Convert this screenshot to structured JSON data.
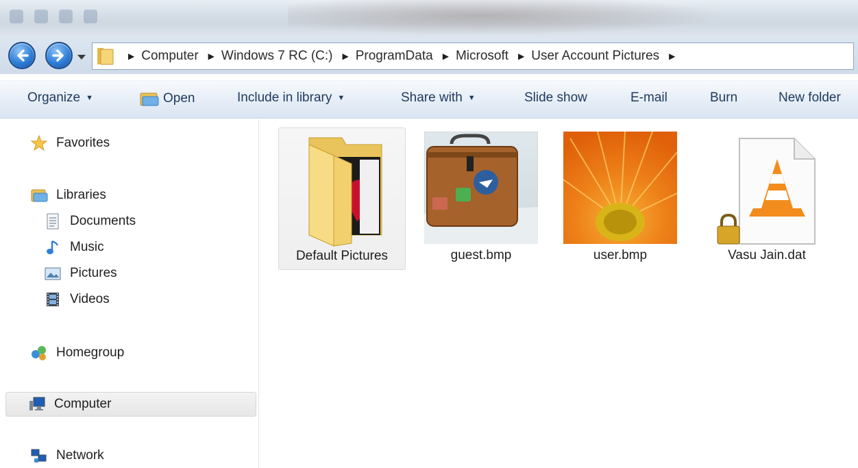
{
  "address_bar": {
    "breadcrumbs": [
      "Computer",
      "Windows 7 RC (C:)",
      "ProgramData",
      "Microsoft",
      "User Account Pictures"
    ]
  },
  "command_bar": {
    "organize": "Organize",
    "open": "Open",
    "include_in_library": "Include in library",
    "share_with": "Share with",
    "slide_show": "Slide show",
    "email": "E-mail",
    "burn": "Burn",
    "new_folder": "New folder"
  },
  "navigation": {
    "favorites": "Favorites",
    "libraries": "Libraries",
    "documents": "Documents",
    "music": "Music",
    "pictures": "Pictures",
    "videos": "Videos",
    "homegroup": "Homegroup",
    "computer": "Computer",
    "network": "Network"
  },
  "files": [
    {
      "name": "Default Pictures",
      "icon": "folder-icon"
    },
    {
      "name": "guest.bmp",
      "icon": "suitcase-thumbnail"
    },
    {
      "name": "user.bmp",
      "icon": "flower-thumbnail"
    },
    {
      "name": "Vasu Jain.dat",
      "icon": "vlc-file-icon"
    }
  ],
  "colors": {
    "accent": "#1e395b",
    "selection": "#e6e6e6"
  }
}
